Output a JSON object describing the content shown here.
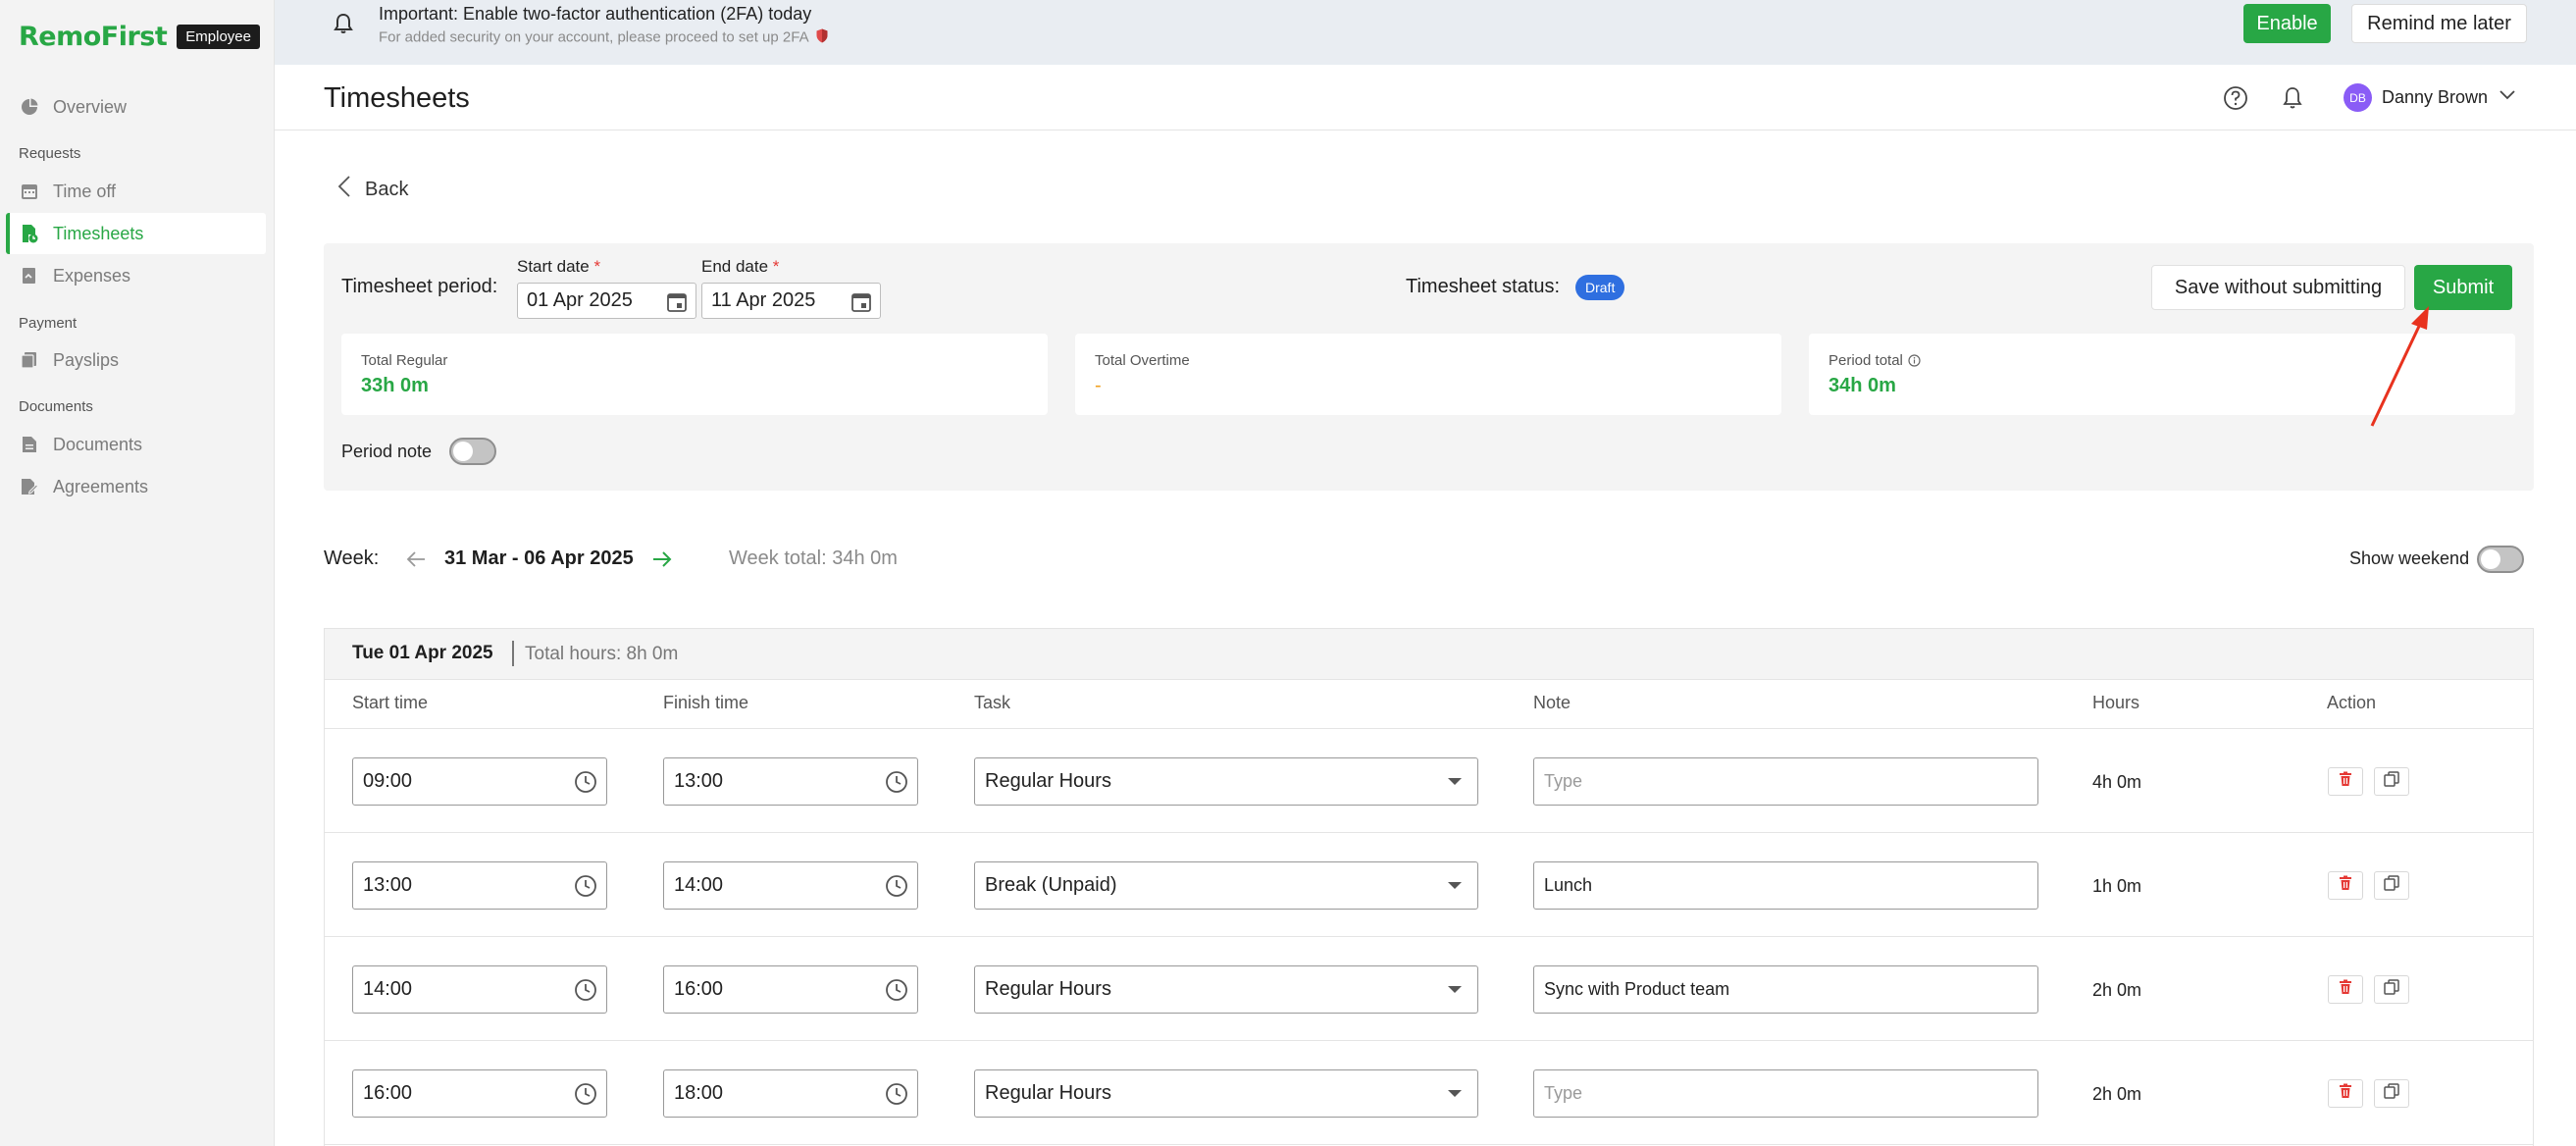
{
  "brand": {
    "name": "RemoFirst",
    "badge": "Employee"
  },
  "sidebar": {
    "items": [
      {
        "label": "Overview",
        "icon": "pie-chart-icon"
      },
      {
        "section": "Requests"
      },
      {
        "label": "Time off",
        "icon": "calendar-icon"
      },
      {
        "label": "Timesheets",
        "icon": "timesheet-icon",
        "active": true
      },
      {
        "label": "Expenses",
        "icon": "receipt-icon"
      },
      {
        "section": "Payment"
      },
      {
        "label": "Payslips",
        "icon": "payslip-icon"
      },
      {
        "section": "Documents"
      },
      {
        "label": "Documents",
        "icon": "document-icon"
      },
      {
        "label": "Agreements",
        "icon": "agreement-icon"
      }
    ]
  },
  "banner": {
    "title": "Important: Enable two-factor authentication (2FA) today",
    "subtitle": "For added security on your account, please proceed to set up 2FA",
    "enable_label": "Enable",
    "remind_label": "Remind me later"
  },
  "header": {
    "title": "Timesheets",
    "user": {
      "initials": "DB",
      "name": "Danny Brown"
    }
  },
  "back_label": "Back",
  "period": {
    "label": "Timesheet period:",
    "start_label": "Start date",
    "start_value": "01 Apr 2025",
    "end_label": "End date",
    "end_value": "11 Apr 2025",
    "required_mark": "*",
    "status_label": "Timesheet status:",
    "status_value": "Draft",
    "save_label": "Save without submitting",
    "submit_label": "Submit",
    "totals": [
      {
        "label": "Total Regular",
        "value": "33h 0m"
      },
      {
        "label": "Total Overtime",
        "value": "-"
      },
      {
        "label": "Period total",
        "value": "34h 0m"
      }
    ],
    "note_label": "Period note",
    "note_enabled": false
  },
  "week": {
    "label": "Week:",
    "range": "31 Mar - 06 Apr 2025",
    "total": "Week total: 34h 0m",
    "show_weekend_label": "Show weekend",
    "show_weekend_enabled": false
  },
  "day": {
    "date": "Tue 01 Apr 2025",
    "total": "Total hours: 8h 0m",
    "columns": [
      "Start time",
      "Finish time",
      "Task",
      "Note",
      "Hours",
      "Action"
    ],
    "rows": [
      {
        "start": "09:00",
        "finish": "13:00",
        "task": "Regular Hours",
        "note": "",
        "hours": "4h 0m"
      },
      {
        "start": "13:00",
        "finish": "14:00",
        "task": "Break (Unpaid)",
        "note": "Lunch",
        "hours": "1h 0m"
      },
      {
        "start": "14:00",
        "finish": "16:00",
        "task": "Regular Hours",
        "note": "Sync with Product team",
        "hours": "2h 0m"
      },
      {
        "start": "16:00",
        "finish": "18:00",
        "task": "Regular Hours",
        "note": "",
        "hours": "2h 0m"
      }
    ],
    "note_placeholder": "Type"
  },
  "colors": {
    "accent": "#28a745",
    "draft": "#2f6fe0",
    "danger": "#e53935",
    "annotation": "#e8321e"
  }
}
